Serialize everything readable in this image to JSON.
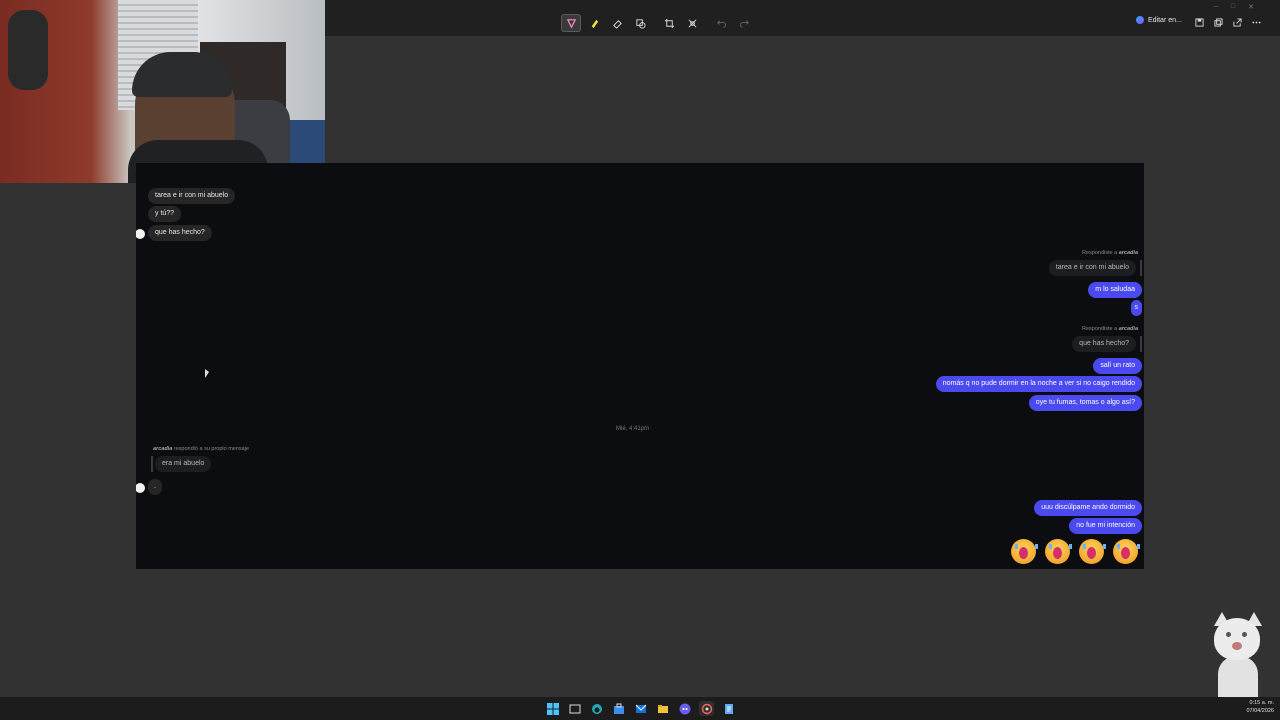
{
  "toolbar": {
    "tools": [
      "select-tool",
      "highlighter-tool",
      "eraser-tool",
      "shapes-tool",
      "crop-tool",
      "background-removal-tool",
      "undo",
      "redo"
    ],
    "edit_label": "Editar en...",
    "right_tools": [
      "save-icon",
      "copy-icon",
      "share-icon",
      "more-icon"
    ]
  },
  "chat": {
    "incoming_top": [
      {
        "text": "tarea e ir con mi abuelo"
      },
      {
        "text": "y tú??"
      },
      {
        "text": "que has hecho?"
      }
    ],
    "reply1": {
      "prefix": "Respondiste a ",
      "name": "arcadia",
      "quoted": "tarea e ir con mi abuelo"
    },
    "outgoing1": [
      "m lo saludaa",
      "s"
    ],
    "reply2": {
      "prefix": "Respondiste a ",
      "name": "arcadia",
      "quoted": "que has hecho?"
    },
    "outgoing2": [
      "salí un rato",
      "nomás q no pude dormir en la noche a ver si no caigo rendido",
      "oye tu fumas, tomas o algo así?"
    ],
    "divider": "Mié, 4:41pm",
    "self_reply": {
      "name": "arcadia",
      "suffix": " respondió a su propio mensaje",
      "quoted": "era mi abuelo"
    },
    "incoming_dot": ".",
    "outgoing3": [
      "uuu discúlpame ando dormido",
      "no fue mi intención"
    ],
    "emoji_count": 4
  },
  "taskbar": {
    "icons": [
      "windows-start-icon",
      "task-view-icon",
      "edge-icon",
      "store-icon",
      "mail-icon",
      "file-explorer-icon",
      "discord-icon",
      "snipping-tool-icon",
      "notepad-icon"
    ],
    "time": "0:15 a. m.",
    "date": "07/04/2026"
  }
}
